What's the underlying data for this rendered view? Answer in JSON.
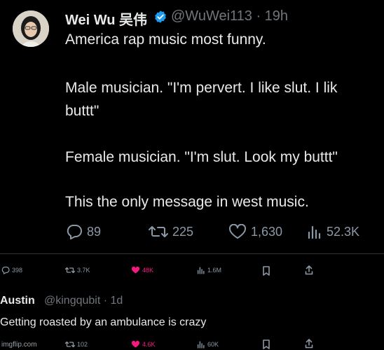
{
  "tweet": {
    "author_name": "Wei Wu 吴伟",
    "handle_time": "@WuWei113 · 19h",
    "lines": [
      "America rap music most funny.",
      "Male musician. \"I'm pervert. I like slut. I lik",
      "buttt\"",
      "Female musician. \"I'm slut. Look my buttt\"",
      "This the only message in west music."
    ],
    "stats": {
      "replies": "89",
      "retweets": "225",
      "likes": "1,630",
      "views": "52.3K"
    }
  },
  "quote_actions": {
    "replies": "398",
    "retweets": "3.7K",
    "likes": "48K",
    "views": "1.6M"
  },
  "reply": {
    "author_name": "Austin",
    "handle_time": "@kingqubit · 1d",
    "text": "Getting roasted by an ambulance is crazy",
    "stats": {
      "retweets": "102",
      "likes": "4.6K",
      "views": "60K"
    }
  },
  "watermark": "imgflip.com",
  "colors": {
    "background": "#000000",
    "text": "#e7e9ea",
    "muted": "#71767b",
    "verified": "#1d9bf0",
    "like_pink": "#f91880"
  }
}
